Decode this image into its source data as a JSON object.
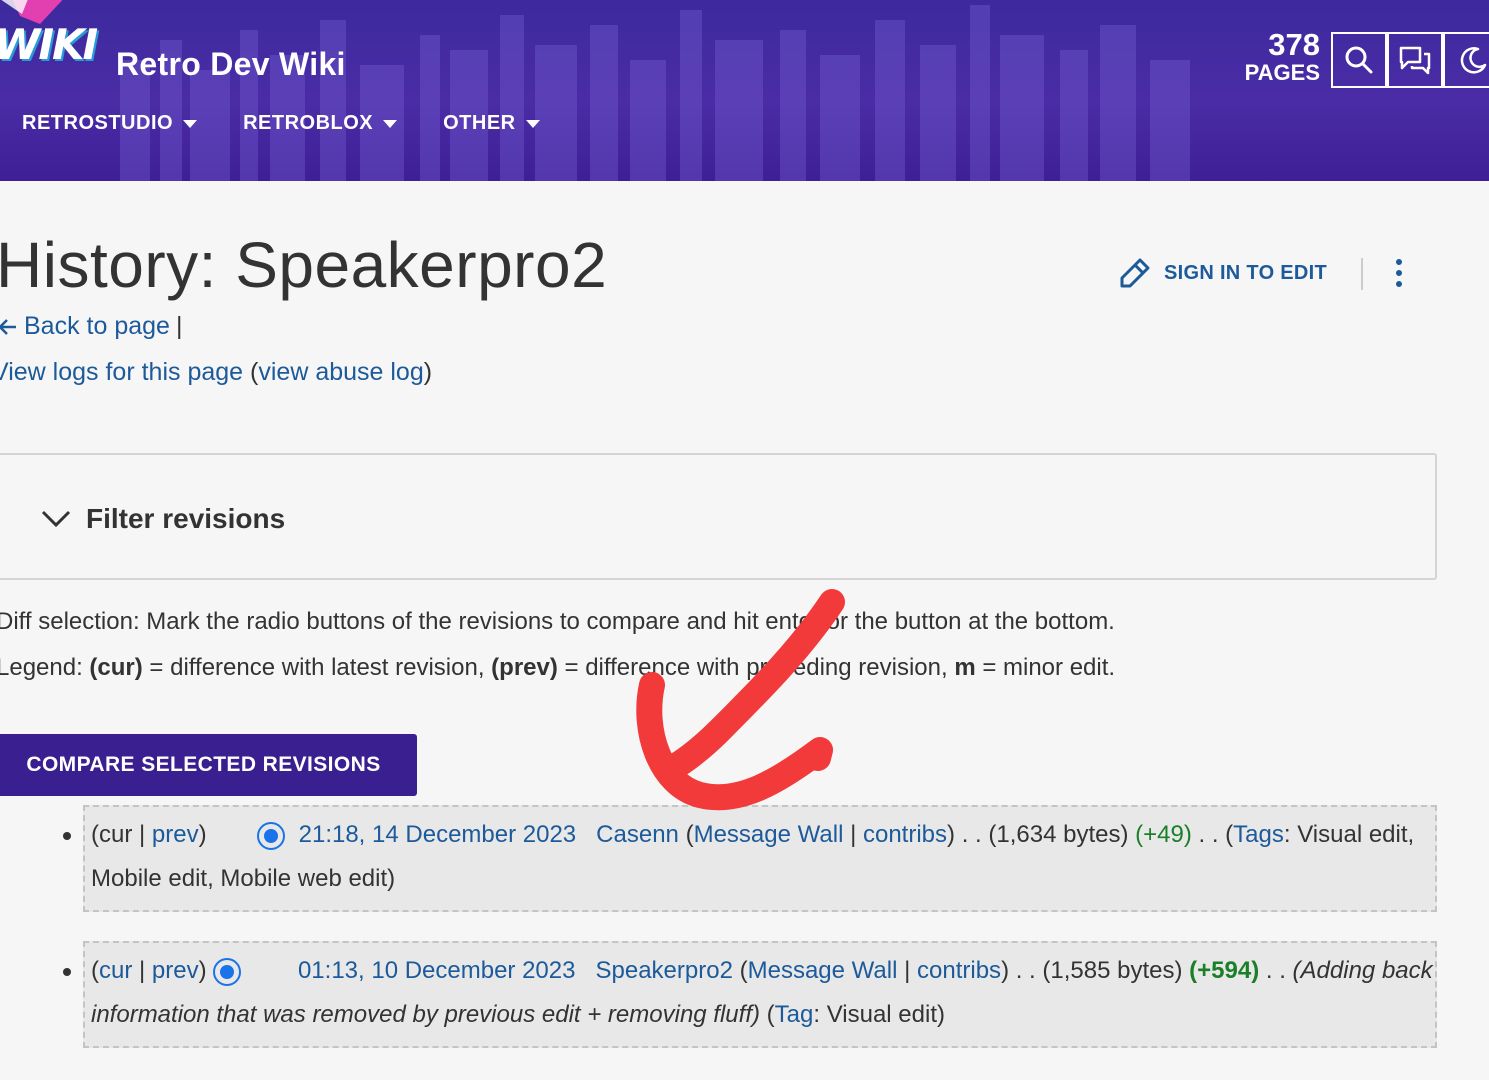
{
  "header": {
    "logo_text": "WIKI",
    "site_title": "Retro Dev Wiki",
    "nav": [
      "RETROSTUDIO",
      "RETROBLOX",
      "OTHER"
    ],
    "pages_count": "378",
    "pages_label": "PAGES",
    "icons": [
      "search-icon",
      "discussions-icon",
      "dark-mode-icon"
    ]
  },
  "page": {
    "title": "History: Speakerpro2",
    "sign_in_label": "SIGN IN TO EDIT",
    "back_label": "Back to page",
    "back_sep": "|",
    "logs_label": "View logs for this page",
    "abuse_label": "view abuse log"
  },
  "filter": {
    "label": "Filter revisions"
  },
  "info": {
    "diff_selection": "Diff selection: Mark the radio buttons of the revisions to compare and hit enter or the button at the bottom.",
    "legend_prefix": "Legend: ",
    "legend_cur": "(cur)",
    "legend_cur_desc": " = difference with latest revision, ",
    "legend_prev": "(prev)",
    "legend_prev_desc": " = difference with preceding revision, ",
    "legend_m": "m",
    "legend_m_desc": " = minor edit."
  },
  "compare_button": "COMPARE SELECTED REVISIONS",
  "revisions": [
    {
      "cur": "cur",
      "prev": "prev",
      "timestamp": "21:18, 14 December 2023",
      "user": "Casenn",
      "message_wall": "Message Wall",
      "contribs": "contribs",
      "size": "(1,634 bytes)",
      "diff": "(+49)",
      "tags_label": "Tags",
      "tags": "Visual edit, Mobile edit, Mobile web edit"
    },
    {
      "cur": "cur",
      "prev": "prev",
      "timestamp": "01:13, 10 December 2023",
      "user": "Speakerpro2",
      "message_wall": "Message Wall",
      "contribs": "contribs",
      "size": "(1,585 bytes)",
      "diff": "(+594)",
      "summary": "(Adding back information that was removed by previous edit + removing fluff)",
      "tags_label": "Tag",
      "tags": "Visual edit"
    }
  ],
  "colors": {
    "header": "#4a2ca6",
    "link": "#1d5a9a",
    "button": "#3a1f91",
    "positive_diff": "#1a7f28",
    "annotation": "#f23a3a"
  }
}
